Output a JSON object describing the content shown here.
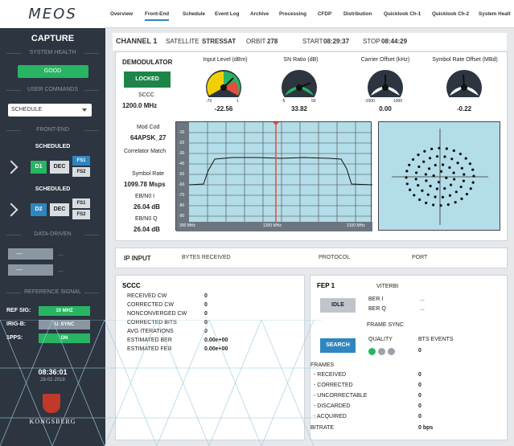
{
  "brand": {
    "logo": "MEOS",
    "company": "KONGSBERG"
  },
  "sidebar": {
    "title": "CAPTURE",
    "system_health": {
      "title": "SYSTEM HEALTH",
      "status": "GOOD"
    },
    "user_commands": {
      "title": "USER COMMANDS",
      "select_value": "SCHEDULE"
    },
    "front_end": {
      "title": "FRONT-END",
      "rows": [
        {
          "label": "SCHEDULED",
          "d": "D1",
          "dec": "DEC",
          "fs1": "FS1",
          "fs2": "FS2"
        },
        {
          "label": "SCHEDULED",
          "d": "D2",
          "dec": "DEC",
          "fs1": "FS1",
          "fs2": "FS2"
        }
      ]
    },
    "data_driven": {
      "title": "DATA-DRIVEN",
      "items": [
        {
          "box": "---",
          "text": "..."
        },
        {
          "box": "---",
          "text": "..."
        }
      ]
    },
    "reference_signal": {
      "title": "REFERENCE SIGNAL",
      "rows": [
        {
          "key": "REF SIG:",
          "value": "10 MHZ"
        },
        {
          "key": "IRIG-B:",
          "value": "U. SYNC"
        },
        {
          "key": "1PPS:",
          "value": "ON"
        }
      ]
    },
    "clock": {
      "time": "08:36:01",
      "date": "28-02-2018"
    }
  },
  "topnav": {
    "tabs": [
      "Overview",
      "Front-End",
      "Schedule",
      "Event Log",
      "Archive",
      "Processing",
      "CFDP",
      "Distribution",
      "Quicklook Ch-1",
      "Quicklook Ch-2",
      "System Healt"
    ],
    "active": "Front-End"
  },
  "channel": {
    "name": "CHANNEL 1",
    "satellite_label": "SATELLITE",
    "satellite": "STRESSAT",
    "orbit_label": "ORBIT",
    "orbit": "278",
    "start_label": "START",
    "start": "08:29:37",
    "stop_label": "STOP",
    "stop": "08:44:29"
  },
  "demodulator": {
    "title": "DEMODULATOR",
    "status": "LOCKED",
    "coding": "SCCC",
    "freq": "1200.0 MHz",
    "mod_cod_label": "Mod Cod",
    "mod_cod": "64APSK_27",
    "correlator": "Correlator Match",
    "symbol_rate_label": "Symbol Rate",
    "symbol_rate": "1099.78 Msps",
    "ebn0i_label": "EB/N0 I",
    "ebn0i": "26.04 dB",
    "ebn0q_label": "EB/N0 Q",
    "ebn0q": "26.04 dB",
    "gauges": [
      {
        "title": "Input Level (dBm)",
        "value": "-22.56",
        "min": "-70",
        "max": "1"
      },
      {
        "title": "SN Ratio (dB)",
        "value": "33.82",
        "min": "-5",
        "max": "50"
      },
      {
        "title": "Carrier Offset (kHz)",
        "value": "0.00",
        "min": "-1000",
        "max": "1000"
      },
      {
        "title": "Symbol Rate Offset (MBd)",
        "value": "-0.22",
        "min": "",
        "max": ""
      }
    ],
    "spectrum": {
      "y_ticks": [
        "-10",
        "-20",
        "-30",
        "-40",
        "-50",
        "-60",
        "-70",
        "-80",
        "-90"
      ],
      "x_ticks": [
        "300 MHz",
        "1200 MHz",
        "2100 MHz"
      ]
    }
  },
  "ip_input": {
    "title": "IP INPUT",
    "cols": [
      "BYTES RECEIVED",
      "PROTOCOL",
      "PORT"
    ]
  },
  "sccc": {
    "title": "SCCC",
    "rows": [
      {
        "k": "RECEIVED CW",
        "v": "0"
      },
      {
        "k": "CORRECTED CW",
        "v": "0"
      },
      {
        "k": "NONCONVERGED CW",
        "v": "0"
      },
      {
        "k": "CORRECTED BITS",
        "v": "0"
      },
      {
        "k": "AVG ITERATIONS",
        "v": "0"
      },
      {
        "k": "ESTIMATED BER",
        "v": "0.00e+00"
      },
      {
        "k": "ESTIMATED FER",
        "v": "0.00e+00"
      }
    ]
  },
  "fep": {
    "title": "FEP 1",
    "viterbi": "VITERBI",
    "idle": "IDLE",
    "ber_i_label": "BER I",
    "ber_i": "...",
    "ber_q_label": "BER Q",
    "ber_q": "...",
    "frame_sync": "FRAME SYNC",
    "search": "SEARCH",
    "quality": "QUALITY",
    "bts_events_label": "BTS EVENTS",
    "bts_events": "0",
    "frames_label": "FRAMES",
    "frames": [
      {
        "k": "- RECEIVED",
        "v": "0"
      },
      {
        "k": "- CORRECTED",
        "v": "0"
      },
      {
        "k": "- UNCORRECTABLE",
        "v": "0"
      },
      {
        "k": "- DISCARDED",
        "v": "0"
      },
      {
        "k": "- ACQUIRED",
        "v": "0"
      }
    ],
    "bitrate_label": "BITRATE",
    "bitrate": "0 bps"
  },
  "colors": {
    "green": "#28b463",
    "blue": "#2e86c1",
    "sidebar": "#2c3540"
  }
}
